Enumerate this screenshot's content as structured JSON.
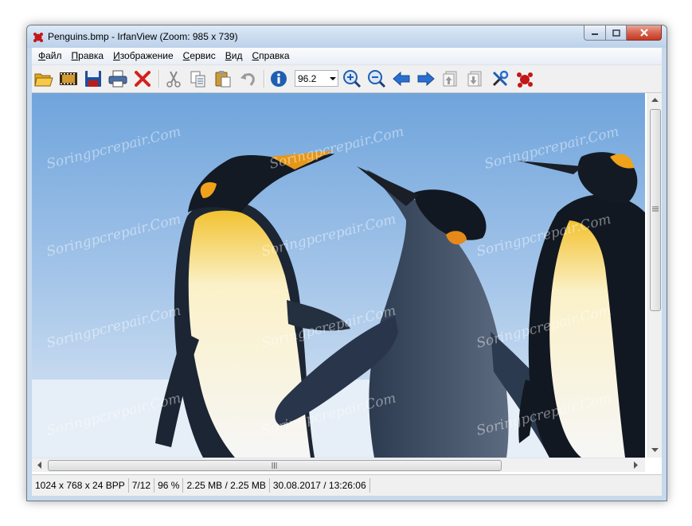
{
  "window": {
    "title": "Penguins.bmp - IrfanView (Zoom: 985 x 739)"
  },
  "menu": [
    {
      "label": "Файл",
      "accel": "Ф",
      "rest": "айл"
    },
    {
      "label": "Правка",
      "accel": "П",
      "rest": "равка"
    },
    {
      "label": "Изображение",
      "accel": "И",
      "rest": "зображение"
    },
    {
      "label": "Сервис",
      "accel": "С",
      "rest": "ервис"
    },
    {
      "label": "Вид",
      "accel": "В",
      "rest": "ид"
    },
    {
      "label": "Справка",
      "accel": "С",
      "rest": "правка"
    }
  ],
  "toolbar": {
    "zoom_value": "96.2",
    "icons": [
      "open-folder-icon",
      "slideshow-icon",
      "save-icon",
      "print-icon",
      "delete-icon",
      "cut-icon",
      "copy-icon",
      "paste-icon",
      "undo-icon",
      "info-icon",
      "zoom-in-icon",
      "zoom-out-icon",
      "previous-icon",
      "next-icon",
      "first-page-icon",
      "last-page-icon",
      "settings-icon",
      "irfanview-icon"
    ]
  },
  "status": {
    "dimensions": "1024 x 768 x 24 BPP",
    "file_index": "7/12",
    "zoom": "96 %",
    "size": "2.25 MB / 2.25 MB",
    "datetime": "30.08.2017 / 13:26:06"
  },
  "watermark": "Soringpcrepair.Com",
  "colors": {
    "accent": "#1f5fb2",
    "close": "#c23a24"
  }
}
